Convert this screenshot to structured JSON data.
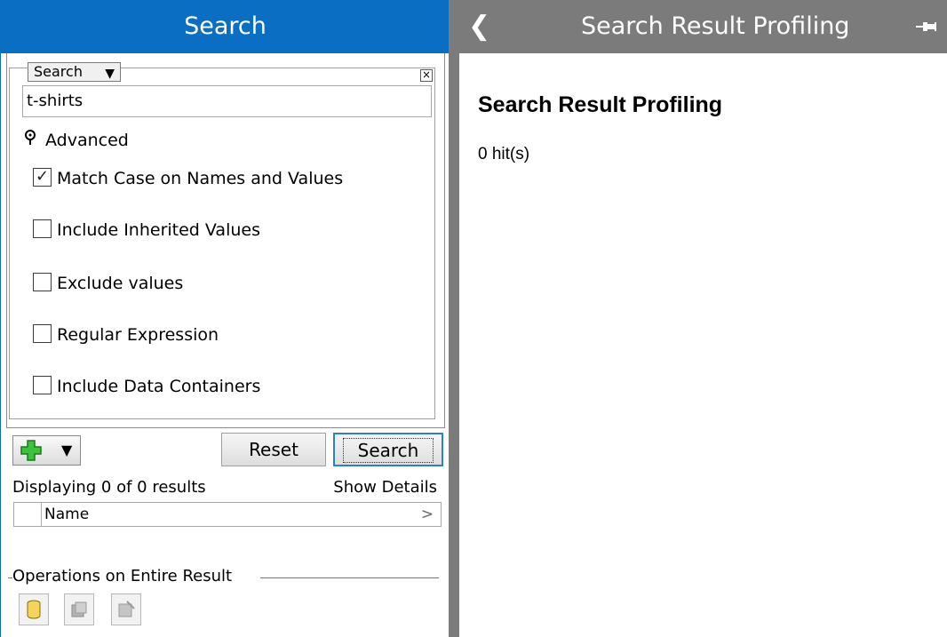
{
  "left_panel": {
    "title": "Search",
    "mode_select": "Search",
    "query_value": "t-shirts",
    "advanced_label": "Advanced",
    "options": [
      {
        "label": "Match Case on Names and Values",
        "checked": true
      },
      {
        "label": "Include Inherited Values",
        "checked": false
      },
      {
        "label": "Exclude values",
        "checked": false
      },
      {
        "label": "Regular Expression",
        "checked": false
      },
      {
        "label": "Include Data Containers",
        "checked": false
      }
    ],
    "reset_label": "Reset",
    "search_label": "Search",
    "displaying_text": "Displaying 0 of 0 results",
    "show_details": "Show Details",
    "column_name": "Name",
    "operations_label": "Operations on Entire Result"
  },
  "right_panel": {
    "title": "Search Result Profiling",
    "heading": "Search Result Profiling",
    "hits": "0 hit(s)"
  },
  "colors": {
    "left_header": "#0a6fc2",
    "right_header": "#7b7b7b"
  }
}
